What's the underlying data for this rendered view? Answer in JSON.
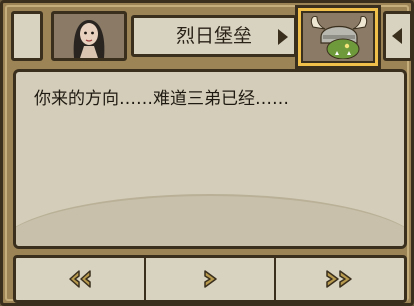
{
  "header": {
    "location_title": "烈日堡垒"
  },
  "dialog": {
    "text": "你来的方向……难道三弟已经……"
  },
  "icons": {
    "left_portrait": "female-character-portrait-icon",
    "right_portrait": "horned-helmet-orc-portrait-icon",
    "back": "double-chevron-left-icon",
    "next": "chevron-right-icon",
    "fast_forward": "double-chevron-right-icon"
  },
  "colors": {
    "frame": "#9c8456",
    "panel": "#d8d2c0",
    "border": "#3a2f1d",
    "highlight": "#f0c04a",
    "arrow": "#b89a4e"
  }
}
